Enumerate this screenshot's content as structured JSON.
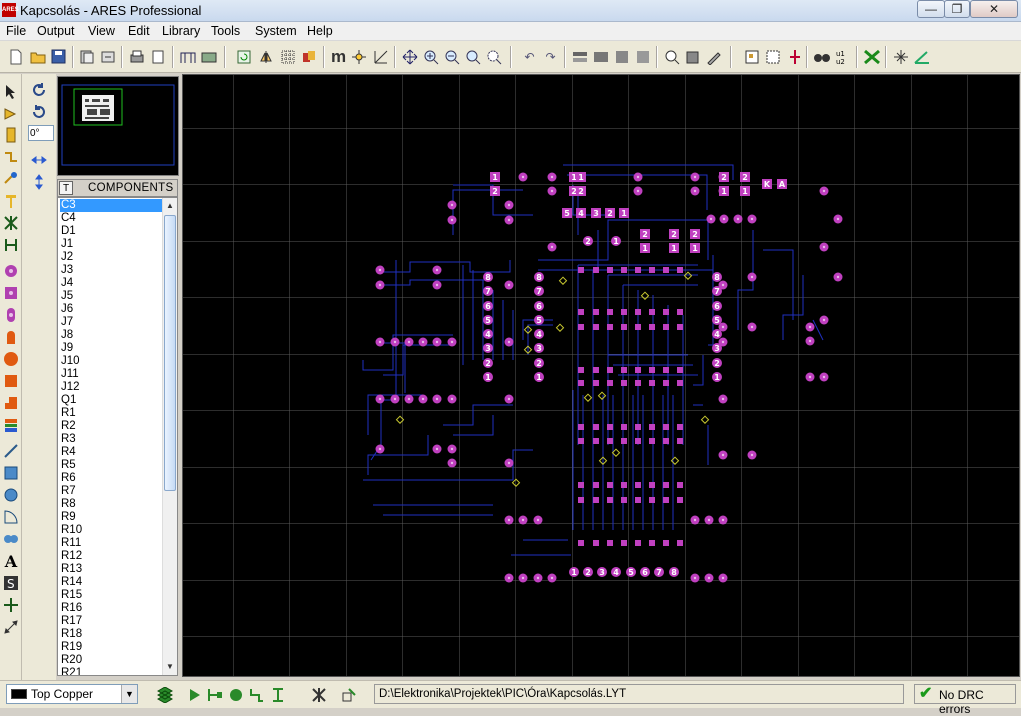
{
  "window": {
    "title": "Kapcsolás - ARES Professional",
    "app_icon": "ARES",
    "buttons": [
      "—",
      "❐",
      "✕"
    ]
  },
  "menu": [
    "File",
    "Output",
    "View",
    "Edit",
    "Library",
    "Tools",
    "System",
    "Help"
  ],
  "toolbar": {
    "icons": [
      "new-icon",
      "open-icon",
      "save-icon",
      "import-icon",
      "export-icon",
      "print-icon",
      "print-setup-icon",
      "netlist-icon",
      "3d-icon",
      "refresh-icon",
      "flip-icon",
      "grid-icon",
      "layers-icon",
      "metric-icon",
      "origin-icon",
      "snap-icon",
      "pan-icon",
      "zoom-in-icon",
      "zoom-out-icon",
      "zoom-all-icon",
      "zoom-area-icon",
      "undo-icon",
      "redo-icon",
      "block-copy-icon",
      "block-move-icon",
      "block-rotate-icon",
      "block-delete-icon",
      "pick-icon",
      "library-icon",
      "tool-icon",
      "autoplace-icon",
      "autoroute-icon",
      "router-icon",
      "search-icon",
      "part-icon",
      "drc-icon",
      "power-plane-icon",
      "design-icon"
    ],
    "metric_label": "m"
  },
  "left_tools": [
    "select-icon",
    "component-icon",
    "package-icon",
    "track-icon",
    "via-icon",
    "zone-icon",
    "ratsnest-icon",
    "connectivity-icon",
    "round-pad-icon",
    "square-pad-icon",
    "dil-pad-icon",
    "edge-pad-icon",
    "circle-pad-icon",
    "rect-pad-icon",
    "polygon-pad-icon",
    "padstack-icon",
    "line-icon",
    "box-icon",
    "circle-icon",
    "arc-icon",
    "path-icon",
    "text-icon",
    "symbol-icon",
    "marker-icon",
    "dimension-icon"
  ],
  "rotation": {
    "angle": "0°"
  },
  "components_panel": {
    "tab_label": "T",
    "title": "COMPONENTS",
    "selected": "C3",
    "items": [
      "C3",
      "C4",
      "D1",
      "J1",
      "J2",
      "J3",
      "J4",
      "J5",
      "J6",
      "J7",
      "J8",
      "J9",
      "J10",
      "J11",
      "J12",
      "Q1",
      "R1",
      "R2",
      "R3",
      "R4",
      "R5",
      "R6",
      "R7",
      "R8",
      "R9",
      "R10",
      "R11",
      "R12",
      "R13",
      "R14",
      "R15",
      "R16",
      "R17",
      "R18",
      "R19",
      "R20",
      "R21"
    ]
  },
  "board": {
    "pad_color": "#c040c0",
    "track_color": "#2030c0",
    "grid_color": "#5a5a5a",
    "pin_labels_left_header": [
      "8",
      "7",
      "6",
      "5",
      "4",
      "3",
      "2",
      "1"
    ],
    "pin_labels_mid_header": [
      "8",
      "7",
      "6",
      "5",
      "4",
      "3",
      "2",
      "1"
    ],
    "pin_labels_right_header": [
      "8",
      "7",
      "6",
      "5",
      "4",
      "3",
      "2",
      "1"
    ],
    "pin_labels_bottom": [
      "1",
      "2",
      "3",
      "4",
      "5",
      "6",
      "7",
      "8"
    ],
    "pin_labels_top_row": [
      "5",
      "4",
      "3",
      "2",
      "1"
    ],
    "pin_labels_top_left": [
      "1",
      "2"
    ],
    "pin_labels_top_mid": [
      "1",
      "2"
    ],
    "pin_labels_top_right": [
      "2",
      "1",
      "2",
      "1"
    ],
    "pin_labels_ka": [
      "K",
      "A"
    ],
    "pin_labels_misc": [
      "2",
      "1",
      "2",
      "1",
      "2",
      "1",
      "2",
      "1",
      "2",
      "1"
    ]
  },
  "status": {
    "layer": "Top Copper",
    "path": "D:\\Elektronika\\Projektek\\PIC\\Óra\\Kapcsolás.LYT",
    "drc": "No DRC errors"
  }
}
